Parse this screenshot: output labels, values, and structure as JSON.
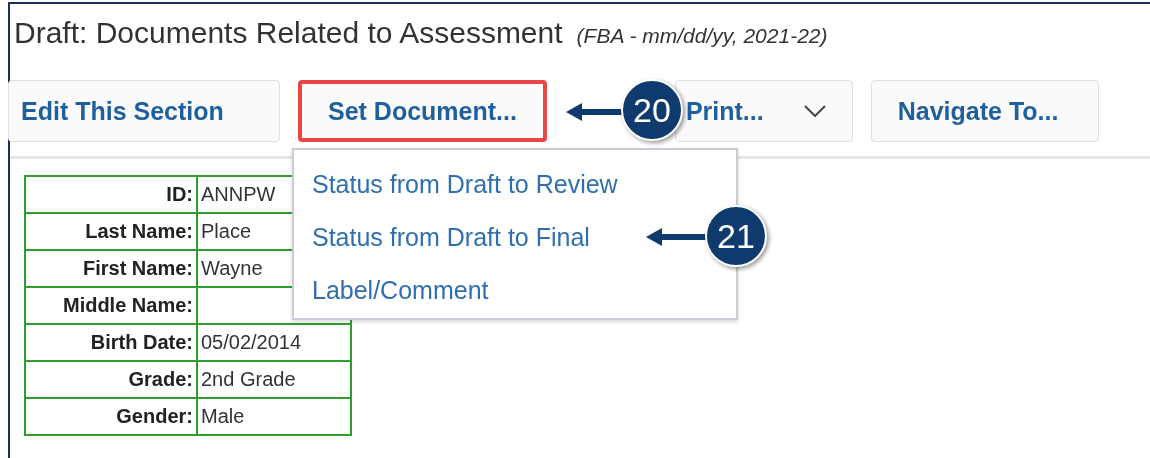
{
  "title": "Draft: Documents Related to Assessment",
  "subtitle": "(FBA - mm/dd/yy, 2021-22)",
  "toolbar": [
    {
      "label": "Edit This Section",
      "kind": "button",
      "highlighted": false
    },
    {
      "label": "Set Document...",
      "kind": "button",
      "highlighted": true
    },
    {
      "label": "Print...",
      "kind": "dropdown",
      "highlighted": false
    },
    {
      "label": "Navigate To...",
      "kind": "button",
      "highlighted": false
    }
  ],
  "menu": {
    "items": [
      "Status from Draft to Review",
      "Status from Draft to Final",
      "Label/Comment"
    ]
  },
  "callouts": [
    {
      "number": "20"
    },
    {
      "number": "21"
    }
  ],
  "student": {
    "rows": [
      {
        "label": "ID:",
        "value": "ANNPW"
      },
      {
        "label": "Last Name:",
        "value": "Place"
      },
      {
        "label": "First Name:",
        "value": "Wayne"
      },
      {
        "label": "Middle Name:"
      },
      {
        "label": "Birth Date:",
        "value": "05/02/2014"
      },
      {
        "label": "Grade:",
        "value": "2nd Grade"
      },
      {
        "label": "Gender:",
        "value": "Male"
      }
    ]
  }
}
